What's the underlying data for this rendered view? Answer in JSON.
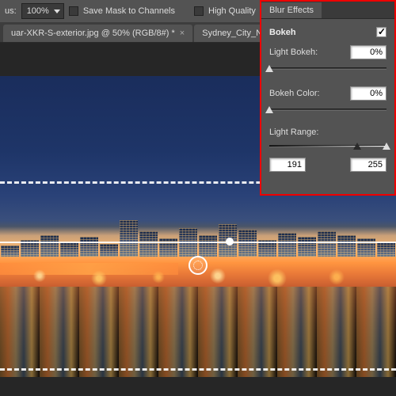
{
  "toolbar": {
    "focus_label": "us:",
    "focus_value": "100%",
    "save_mask_label": "Save Mask to Channels",
    "high_quality_label": "High Quality"
  },
  "tabs": [
    {
      "label": "uar-XKR-S-exterior.jpg @ 50% (RGB/8#) *"
    },
    {
      "label": "Sydney_City_Night_Life_by_jstudi"
    }
  ],
  "panel": {
    "tab_label": "Blur Effects",
    "section_title": "Bokeh",
    "light_bokeh_label": "Light Bokeh:",
    "light_bokeh_value": "0%",
    "bokeh_color_label": "Bokeh Color:",
    "bokeh_color_value": "0%",
    "light_range_label": "Light Range:",
    "range_low": "191",
    "range_high": "255"
  }
}
